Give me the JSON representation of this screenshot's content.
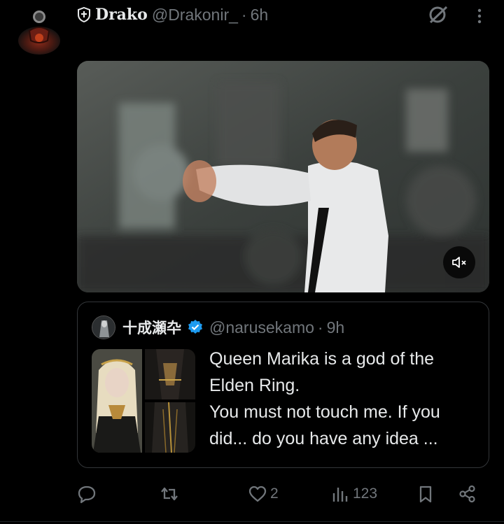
{
  "tweet": {
    "display_name": "Drako",
    "handle": "@Drakonir_",
    "separator": "·",
    "time": "6h",
    "avatar_icon": "shadow-figure-avatar",
    "name_badge_icon": "shield-icon"
  },
  "media": {
    "type": "video",
    "mute_icon": "speaker-muted-icon"
  },
  "quote": {
    "display_name": "十成瀬卆",
    "handle": "@narusekamo",
    "separator": "·",
    "time": "9h",
    "verified": true,
    "text_lines": [
      "Queen Marika is a god of the",
      "Elden Ring.",
      "You must not touch me. If you",
      "did... do you have any idea ..."
    ]
  },
  "actions": {
    "reply_icon": "reply-icon",
    "retweet_icon": "retweet-icon",
    "like_icon": "heart-icon",
    "like_count": "2",
    "views_icon": "views-icon",
    "views_count": "123",
    "bookmark_icon": "bookmark-icon",
    "share_icon": "share-icon"
  },
  "colors": {
    "background": "#000000",
    "text_primary": "#e7e9ea",
    "text_secondary": "#71767b",
    "verified_blue": "#1d9bf0",
    "border": "#333639"
  }
}
